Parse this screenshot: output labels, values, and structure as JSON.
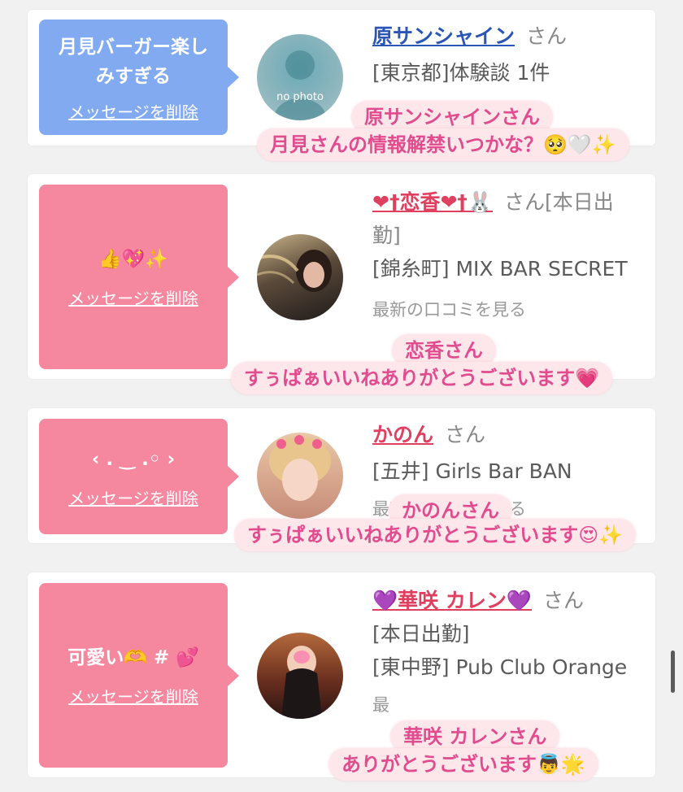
{
  "cards": [
    {
      "bubble_text": "月見バーガー楽しみすぎる",
      "delete_label": "メッセージを削除",
      "name": "原サンシャイン",
      "honorific": "さん",
      "meta1": "[東京都]体験談 1件",
      "avatar_text": "no photo",
      "caption_name": "原サンシャインさん",
      "caption_text": "月見さんの情報解禁いつかな？🥺🤍✨"
    },
    {
      "bubble_text": "👍💖✨",
      "delete_label": "メッセージを削除",
      "name": "❤†恋香❤†🐰",
      "honorific": "さん[本日出勤]",
      "meta1": "[錦糸町] MIX BAR SECRET",
      "more": "最新の口コミを見る",
      "caption_name": "恋香さん",
      "caption_text": "すぅぱぁいいねありがとうございます💗"
    },
    {
      "bubble_text": "‹ . ‿ .◦ ›",
      "delete_label": "メッセージを削除",
      "name": "かのん",
      "honorific": "さん",
      "meta1": "[五井] Girls Bar BAN",
      "more": "最新の口コミを見る",
      "caption_name": "かのんさん",
      "caption_text": "すぅぱぁいいねありがとうございます😍✨"
    },
    {
      "bubble_text": "可愛い🫶 # 💕",
      "delete_label": "メッセージを削除",
      "name": "💜華咲 カレン💜",
      "honorific": "さん",
      "meta1": "[本日出勤]",
      "meta2": "[東中野] Pub Club Orange",
      "more": "最",
      "caption_name": "華咲 カレンさん",
      "caption_text": "ありがとうございます👼🌟"
    }
  ]
}
